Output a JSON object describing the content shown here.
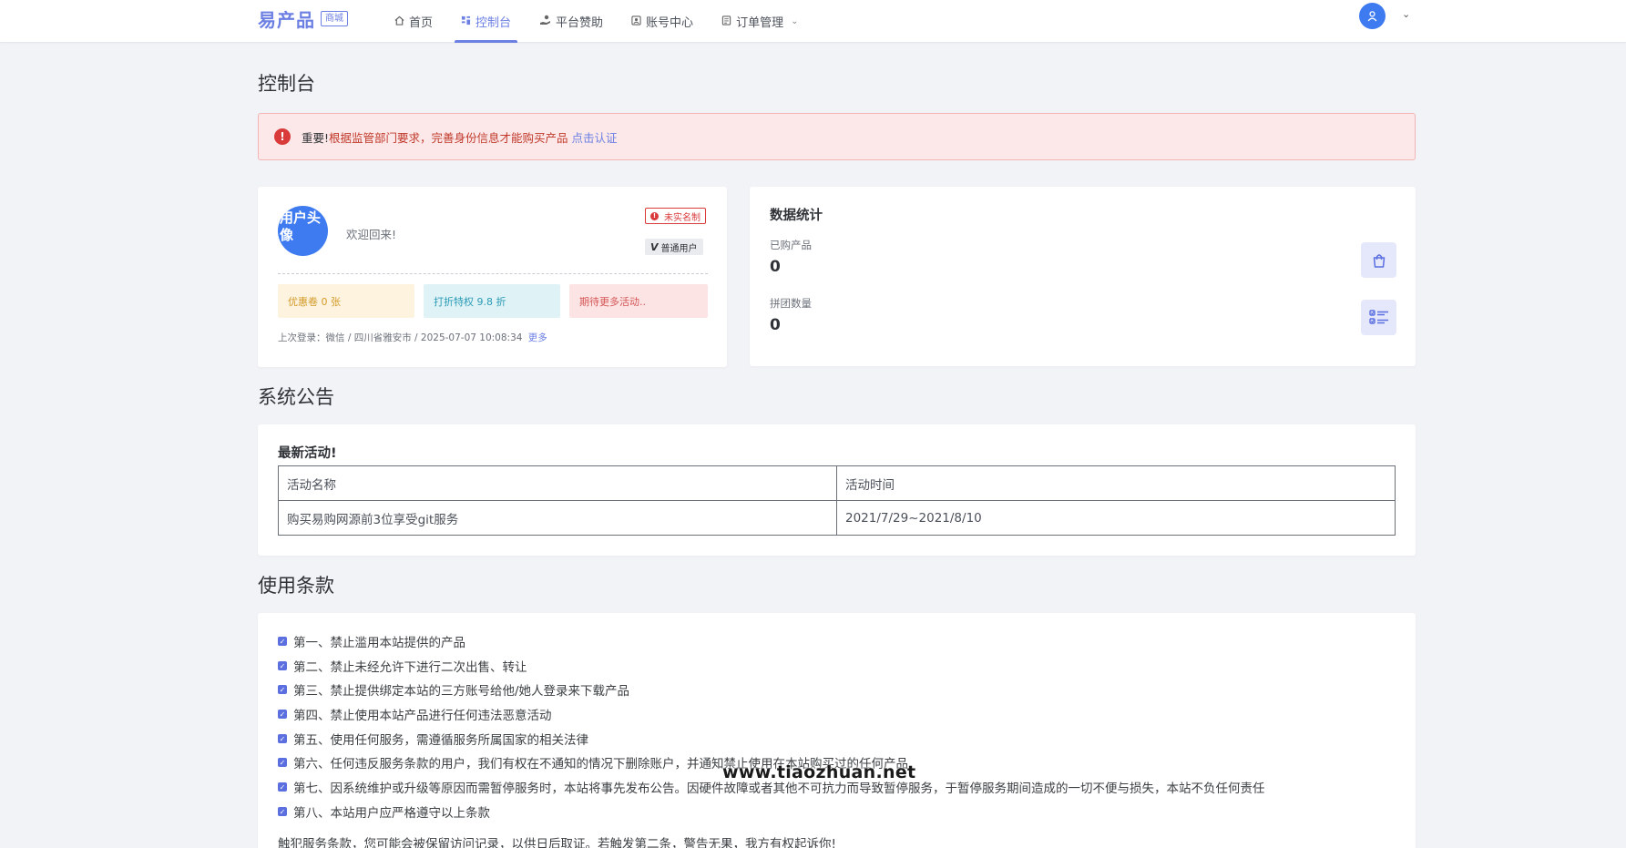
{
  "header": {
    "logo_text": "易产品",
    "logo_badge": "商城",
    "nav": [
      {
        "label": "首页",
        "icon": "home-icon"
      },
      {
        "label": "控制台",
        "icon": "dashboard-icon",
        "active": true
      },
      {
        "label": "平台赞助",
        "icon": "donate-icon"
      },
      {
        "label": "账号中心",
        "icon": "account-icon"
      },
      {
        "label": "订单管理",
        "icon": "order-icon"
      }
    ]
  },
  "page_title": "控制台",
  "alert": {
    "strong": "重要!",
    "message": " 根据监管部门要求，完善身份信息才能购买产品",
    "link": "点击认证"
  },
  "user_card": {
    "avatar_alt": "用户头像",
    "welcome": "欢迎回来!",
    "badge_unverified": "未实名制",
    "badge_level": "普通用户",
    "perks": [
      "优惠卷 0 张",
      "打折特权 9.8 折",
      "期待更多活动.."
    ],
    "last_login": "上次登录：微信 / 四川省雅安市 / 2025-07-07 10:08:34",
    "last_login_more": "更多"
  },
  "stats": {
    "title": "数据统计",
    "items": [
      {
        "label": "已购产品",
        "value": "0",
        "icon": "shopping-bag-icon"
      },
      {
        "label": "拼团数量",
        "value": "0",
        "icon": "checklist-icon"
      }
    ]
  },
  "notice": {
    "section_title": "系统公告",
    "heading": "最新活动!",
    "columns": [
      "活动名称",
      "活动时间"
    ],
    "rows": [
      [
        "购买易购网源前3位享受git服务",
        "2021/7/29~2021/8/10"
      ]
    ]
  },
  "terms": {
    "section_title": "使用条款",
    "items": [
      "第一、禁止滥用本站提供的产品",
      "第二、禁止未经允许下进行二次出售、转让",
      "第三、禁止提供绑定本站的三方账号给他/她人登录来下载产品",
      "第四、禁止使用本站产品进行任何违法恶意活动",
      "第五、使用任何服务，需遵循服务所属国家的相关法律",
      "第六、任何违反服务条款的用户，我们有权在不通知的情况下删除账户，并通知禁止使用在本站购买过的任何产品",
      "第七、因系统维护或升级等原因而需暂停服务时，本站将事先发布公告。因硬件故障或者其他不可抗力而导致暂停服务，于暂停服务期间造成的一切不便与损失，本站不负任何责任",
      "第八、本站用户应严格遵守以上条款"
    ],
    "footer": "触犯服务条款，您可能会被保留访问记录，以供日后取证。若触发第二条，警告无果，我方有权起诉你!"
  },
  "watermark": "www.tiaozhuan.net",
  "colors": {
    "accent": "#6c7fe3",
    "danger": "#d93a3a",
    "avatar": "#3f7bf0"
  }
}
